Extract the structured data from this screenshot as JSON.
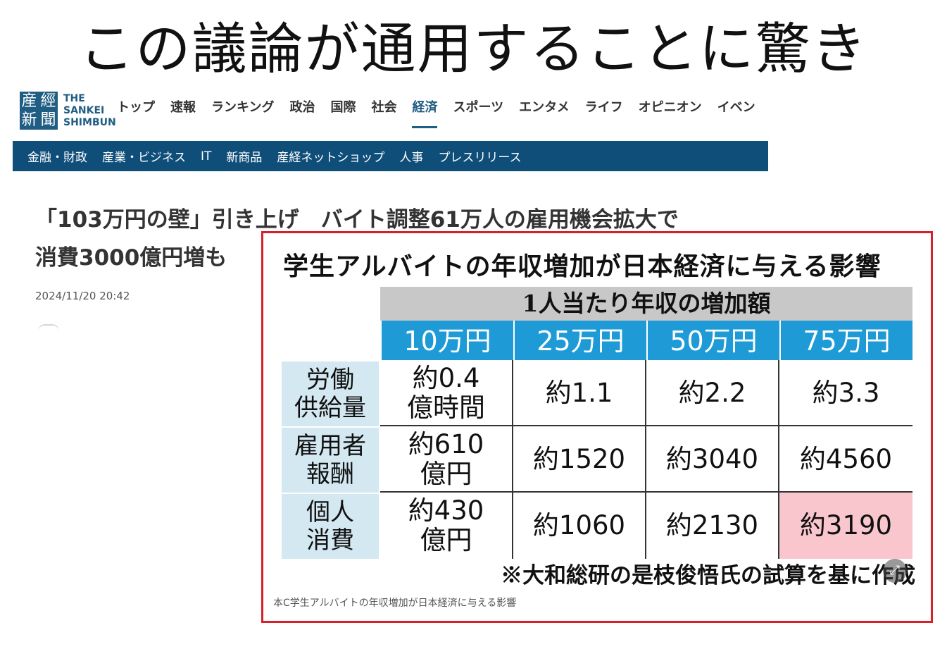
{
  "headline": "この議論が通用することに驚き",
  "site": {
    "logo_kanji": [
      "産",
      "經",
      "新",
      "聞"
    ],
    "logo_text": [
      "THE",
      "SANKEI",
      "SHIMBUN"
    ],
    "nav": [
      "トップ",
      "速報",
      "ランキング",
      "政治",
      "国際",
      "社会",
      "経済",
      "スポーツ",
      "エンタメ",
      "ライフ",
      "オピニオン",
      "イベン"
    ],
    "active_nav": "経済",
    "subnav": [
      "金融・財政",
      "産業・ビジネス",
      "IT",
      "新商品",
      "産経ネットショップ",
      "人事",
      "プレスリリース"
    ],
    "accent_color": "#0f4e79"
  },
  "article": {
    "title_line1": "「103万円の壁」引き上げ　バイト調整61万人の雇用機会拡大で",
    "title_line2": "消費3000億円増も",
    "date": "2024/11/20 20:42"
  },
  "figure": {
    "title": "学生アルバイトの年収増加が日本経済に与える影響",
    "span_header": "1人当たり年収の増加額",
    "columns": [
      "10万円",
      "25万円",
      "50万円",
      "75万円"
    ],
    "rows": [
      {
        "label": [
          "労働",
          "供給量"
        ],
        "cells": [
          [
            "約0.4",
            "億時間"
          ],
          [
            "約1.1"
          ],
          [
            "約2.2"
          ],
          [
            "約3.3"
          ]
        ]
      },
      {
        "label": [
          "雇用者",
          "報酬"
        ],
        "cells": [
          [
            "約610",
            "億円"
          ],
          [
            "約1520"
          ],
          [
            "約3040"
          ],
          [
            "約4560"
          ]
        ]
      },
      {
        "label": [
          "個人",
          "消費"
        ],
        "cells": [
          [
            "約430",
            "億円"
          ],
          [
            "約1060"
          ],
          [
            "約2130"
          ],
          [
            "約3190"
          ]
        ]
      }
    ],
    "highlight_color": "#f9c6cd",
    "note": "※大和総研の是枝俊悟氏の試算を基に作成",
    "caption": "本C学生アルバイトの年収増加が日本経済に与える影響",
    "frame_color": "#d8202a"
  }
}
